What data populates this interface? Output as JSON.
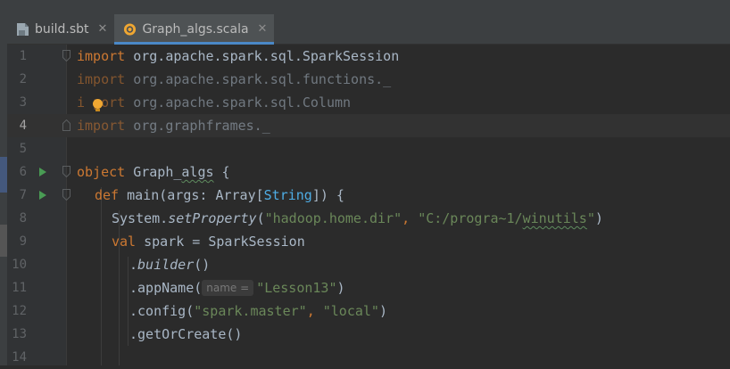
{
  "tabs": [
    {
      "label": "build.sbt",
      "close": "✕",
      "active": false,
      "icon": "sbt-file-icon"
    },
    {
      "label": "Graph_algs.scala",
      "close": "✕",
      "active": true,
      "icon": "scala-object-icon"
    }
  ],
  "code": {
    "line_numbers": [
      "1",
      "2",
      "3",
      "4",
      "5",
      "6",
      "7",
      "8",
      "9",
      "10",
      "11",
      "12",
      "13",
      "14"
    ],
    "l1": {
      "kw": "import",
      "rest": " org.apache.spark.sql.SparkSession"
    },
    "l2": {
      "kw": "import",
      "rest": " org.apache.spark.sql.functions._"
    },
    "l3": {
      "kw_a": "i",
      "kw_b": "port",
      "rest": " org.apache.spark.sql.Column"
    },
    "l4": {
      "kw": "import",
      "rest": " org.graphframes._"
    },
    "l6": {
      "kw": "object",
      "sp": " ",
      "name_a": "Graph_",
      "name_b": "algs",
      "rest": " {"
    },
    "l7": {
      "kw": "def",
      "mid": " main(args: Array[",
      "type": "String",
      "rest": "]) {"
    },
    "l8": {
      "a": "System.",
      "method": "setProperty",
      "b": "(",
      "s1": "\"hadoop.home.dir\"",
      "comma": ", ",
      "s2a": "\"C:/progra~1/",
      "s2b": "winutils",
      "s2c": "\"",
      "end": ")"
    },
    "l9": {
      "kw": "val",
      "rest": " spark = SparkSession"
    },
    "l10": {
      "dot": ".",
      "method": "builder",
      "rest": "()"
    },
    "l11": {
      "pre": ".appName(",
      "hint": "name =",
      "str": "\"Lesson13\"",
      "end": ")"
    },
    "l12": {
      "pre": ".config(",
      "s1": "\"spark.master\"",
      "comma": ", ",
      "s2": "\"local\"",
      "end": ")"
    },
    "l13": {
      "text": ".getOrCreate()"
    }
  },
  "colors": {
    "background": "#2b2b2b",
    "keyword": "#cc7832",
    "string": "#6a8759",
    "text": "#a9b7c6",
    "run_marker": "#499c54",
    "active_tab_underline": "#4a88c7",
    "bulb": "#f0a732"
  }
}
